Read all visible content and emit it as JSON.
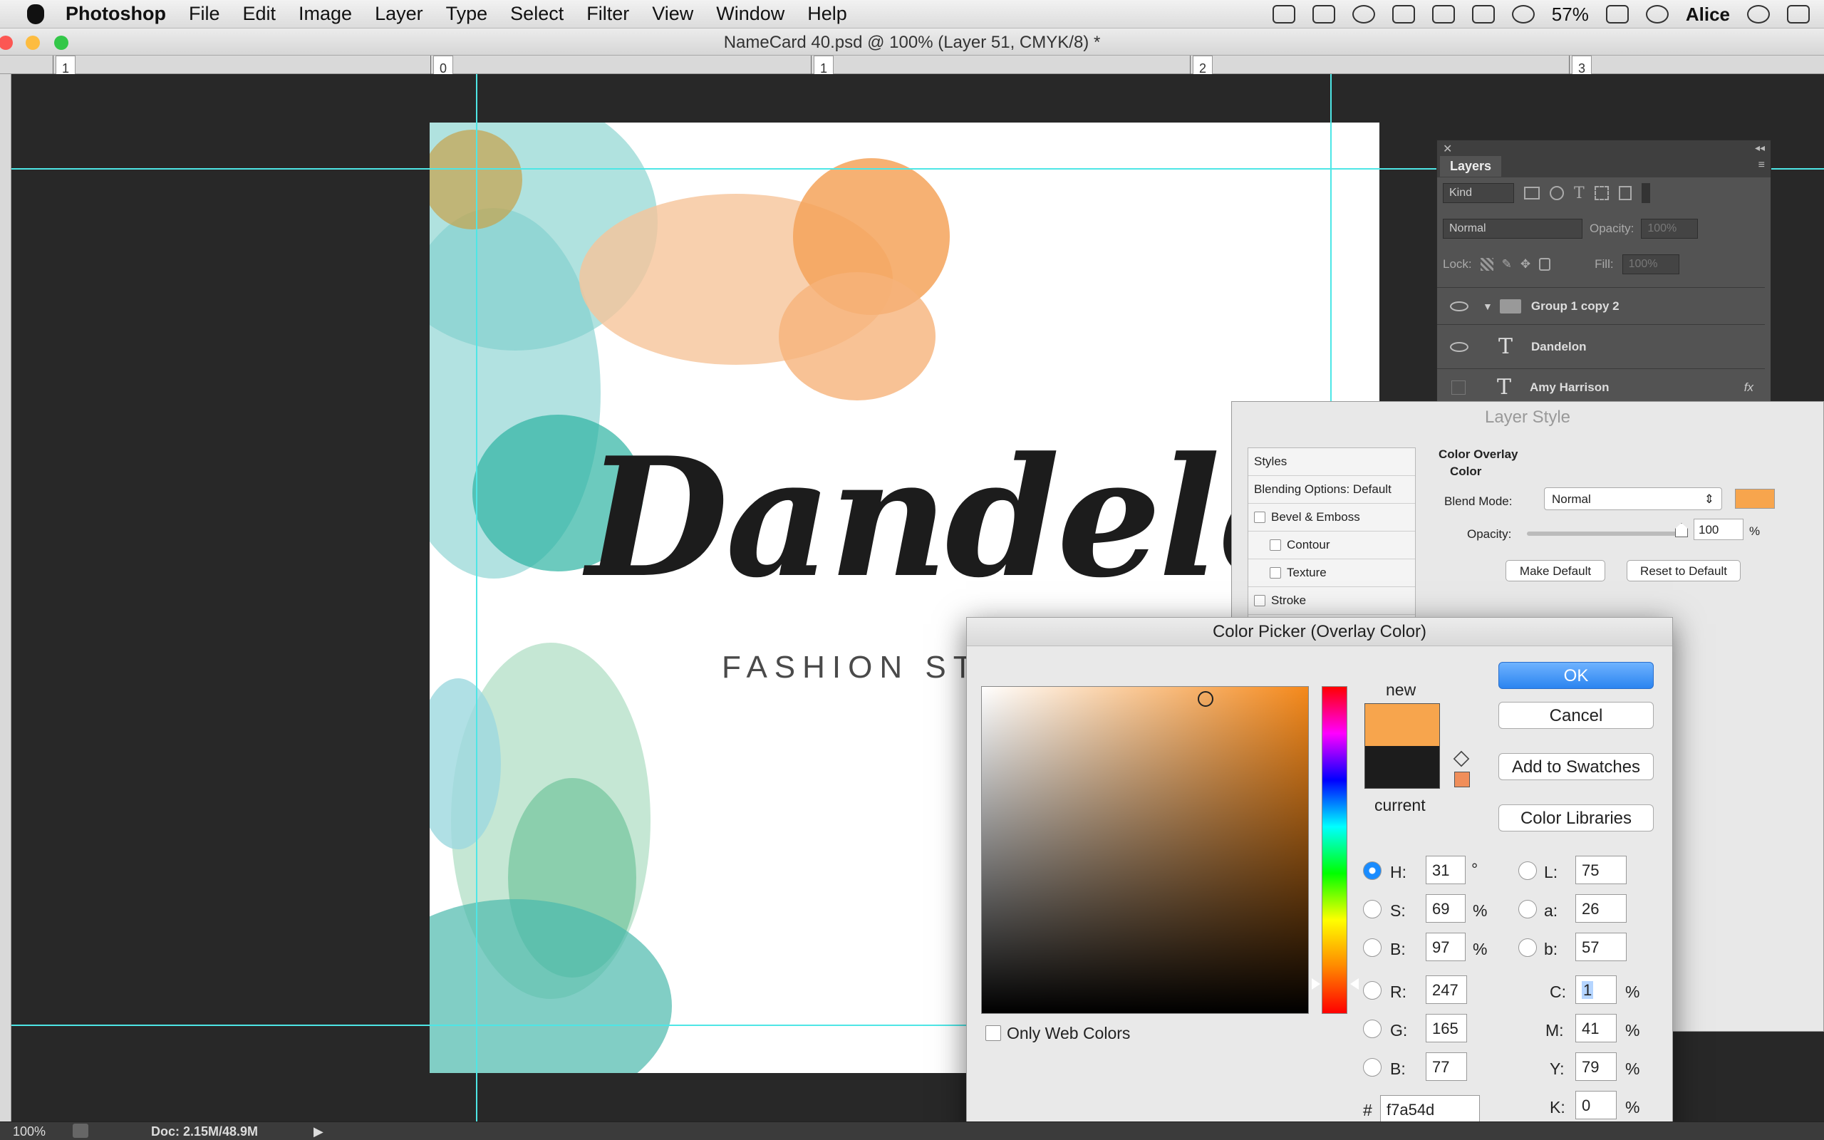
{
  "menubar": {
    "app": "Photoshop",
    "items": [
      "File",
      "Edit",
      "Image",
      "Layer",
      "Type",
      "Select",
      "Filter",
      "View",
      "Window",
      "Help"
    ],
    "battery": "57%",
    "user": "Alice"
  },
  "window": {
    "title": "NameCard 40.psd @ 100% (Layer 51, CMYK/8) *"
  },
  "ruler": {
    "labels": [
      "1",
      "0",
      "1",
      "2",
      "3"
    ]
  },
  "canvas": {
    "brand": "Dandelon",
    "tagline": "FASHION STY"
  },
  "status": {
    "zoom": "100%",
    "doc": "Doc: 2.15M/48.9M"
  },
  "layers": {
    "tab": "Layers",
    "filter": "Kind",
    "blend": "Normal",
    "opacity_label": "Opacity:",
    "opacity": "100%",
    "lock_label": "Lock:",
    "fill_label": "Fill:",
    "fill": "100%",
    "rows": [
      {
        "name": "Group 1 copy 2"
      },
      {
        "name": "Dandelon"
      },
      {
        "name": "Amy Harrison",
        "fx": "fx"
      }
    ]
  },
  "layer_style": {
    "title": "Layer Style",
    "styles": [
      "Styles",
      "Blending Options: Default",
      "Bevel & Emboss",
      "Contour",
      "Texture",
      "Stroke"
    ],
    "section": "Color Overlay",
    "subsection": "Color",
    "blend_label": "Blend Mode:",
    "blend_value": "Normal",
    "opacity_label": "Opacity:",
    "opacity_value": "100",
    "opacity_unit": "%",
    "opacity_level": 1.0,
    "make_default": "Make Default",
    "reset_default": "Reset to Default",
    "overlay_color": "#f7a54d"
  },
  "color_picker": {
    "title": "Color Picker (Overlay Color)",
    "new_label": "new",
    "current_label": "current",
    "ok": "OK",
    "cancel": "Cancel",
    "add_swatches": "Add to Swatches",
    "libraries": "Color Libraries",
    "only_web": "Only Web Colors",
    "hash": "#",
    "hex": "f7a54d",
    "new_color": "#f7a54d",
    "current_color": "#1c1c1c",
    "fields": {
      "H": {
        "label": "H:",
        "value": "31",
        "unit": "°"
      },
      "S": {
        "label": "S:",
        "value": "69",
        "unit": "%"
      },
      "Bv": {
        "label": "B:",
        "value": "97",
        "unit": "%"
      },
      "R": {
        "label": "R:",
        "value": "247"
      },
      "G": {
        "label": "G:",
        "value": "165"
      },
      "Bb": {
        "label": "B:",
        "value": "77"
      },
      "L": {
        "label": "L:",
        "value": "75"
      },
      "a": {
        "label": "a:",
        "value": "26"
      },
      "b": {
        "label": "b:",
        "value": "57"
      },
      "C": {
        "label": "C:",
        "value": "1",
        "unit": "%"
      },
      "M": {
        "label": "M:",
        "value": "41",
        "unit": "%"
      },
      "Y": {
        "label": "Y:",
        "value": "79",
        "unit": "%"
      },
      "K": {
        "label": "K:",
        "value": "0",
        "unit": "%"
      }
    }
  }
}
